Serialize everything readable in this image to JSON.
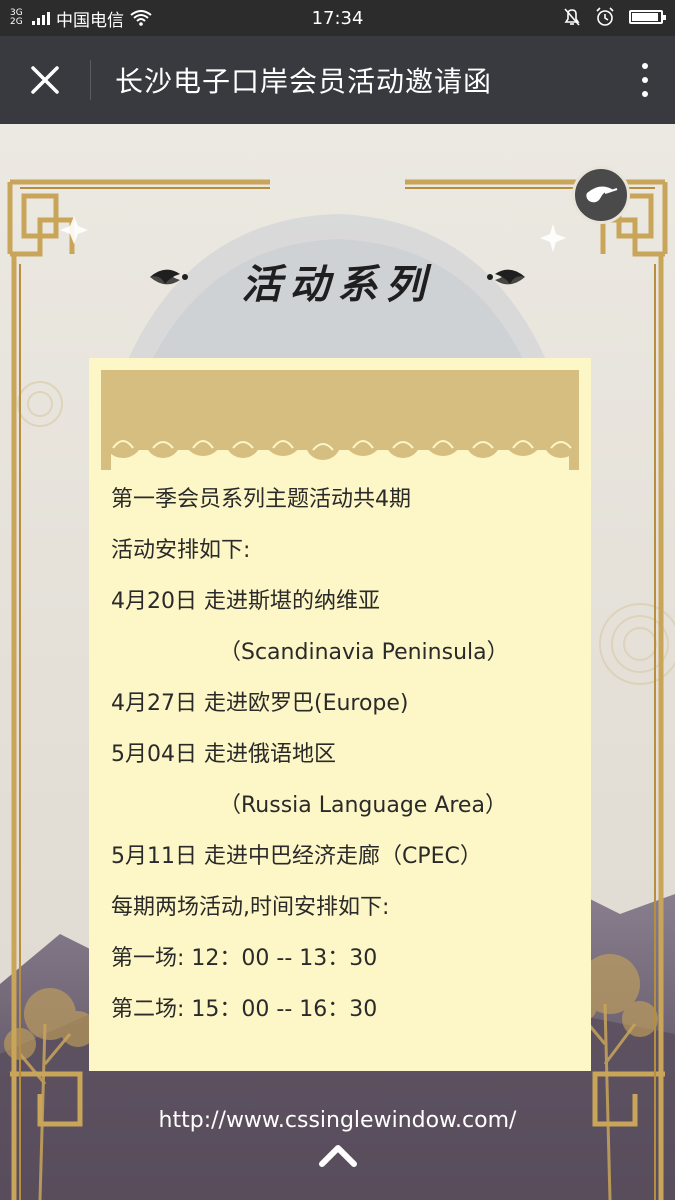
{
  "status_bar": {
    "network": "3G 2G",
    "carrier": "中国电信",
    "time": "17:34",
    "battery_level": 0.85,
    "icons": [
      "signal-icon",
      "wifi-icon",
      "mute-icon",
      "alarm-icon",
      "battery-icon"
    ]
  },
  "nav": {
    "title": "长沙电子口岸会员活动邀请函",
    "close_icon": "close-icon",
    "more_icon": "more-vertical-icon"
  },
  "page": {
    "heading": "活动系列",
    "music_icon": "music-note-icon",
    "card_lines": [
      "第一季会员系列主题活动共4期",
      "活动安排如下:",
      "4月20日 走进斯堪的纳维亚",
      "（Scandinavia Peninsula）",
      "4月27日 走进欧罗巴(Europe)",
      "5月04日 走进俄语地区",
      "（Russia Language Area）",
      "5月11日 走进中巴经济走廊（CPEC）",
      "每期两场活动,时间安排如下:",
      "第一场: 12：00 -- 13：30",
      "第二场: 15：00 -- 16：30"
    ],
    "url": "http://www.cssinglewindow.com/",
    "up_icon": "chevron-up-icon"
  },
  "colors": {
    "status_bg": "#2c2c2c",
    "nav_bg": "#393a3f",
    "card_bg": "#fdf6c6",
    "gold": "#c9a55a",
    "band_gold": "#d6bd80",
    "mountain": "#6e6470"
  }
}
